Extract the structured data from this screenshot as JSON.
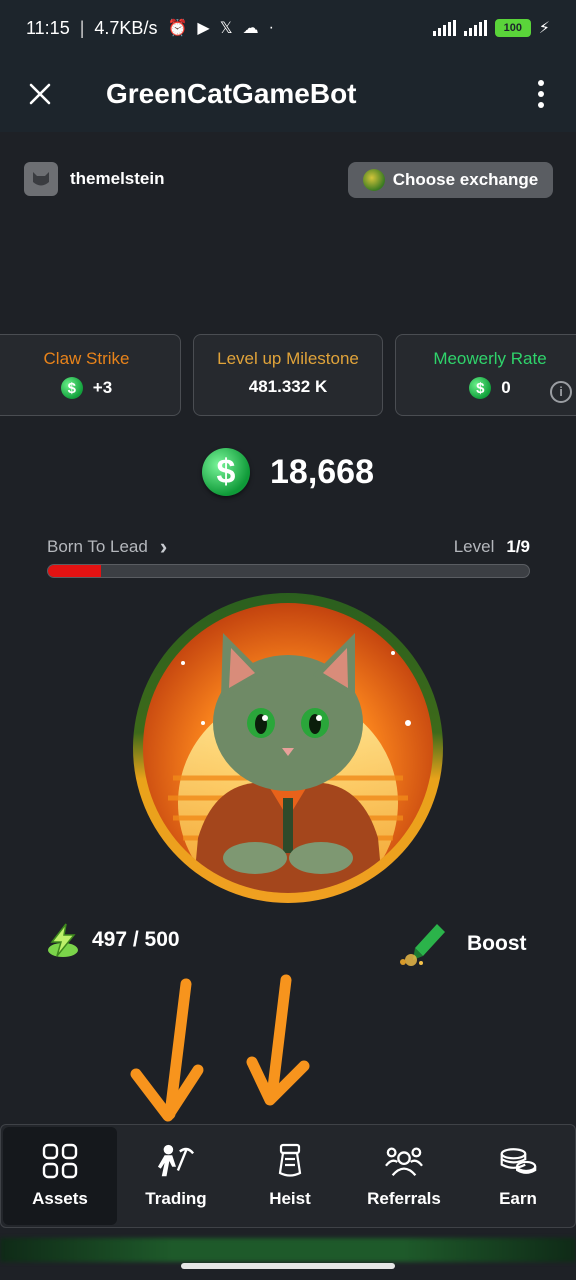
{
  "status_bar": {
    "time": "11:15",
    "speed": "4.7KB/s",
    "battery": "100"
  },
  "app_bar": {
    "title": "GreenCatGameBot"
  },
  "user": {
    "username": "themelstein"
  },
  "exchange_button": {
    "label": "Choose exchange"
  },
  "stats": [
    {
      "label": "Claw Strike",
      "value": "+3",
      "color": "#e8831a"
    },
    {
      "label": "Level up Milestone",
      "value": "481.332 K",
      "color": "#e0a33a"
    },
    {
      "label": "Meowerly Rate",
      "value": "0",
      "color": "#2fd36b"
    }
  ],
  "balance": {
    "amount": "18,668"
  },
  "level": {
    "name": "Born To Lead",
    "label": "Level",
    "value": "1/9",
    "progress": 0.11
  },
  "energy": {
    "value": "497 / 500"
  },
  "boost": {
    "label": "Boost"
  },
  "nav": {
    "items": [
      {
        "label": "Assets",
        "icon": "assets-grid-icon"
      },
      {
        "label": "Trading",
        "icon": "miner-pickaxe-icon"
      },
      {
        "label": "Heist",
        "icon": "money-bag-icon"
      },
      {
        "label": "Referrals",
        "icon": "users-group-icon"
      },
      {
        "label": "Earn",
        "icon": "coins-stack-icon"
      }
    ]
  },
  "colors": {
    "accent_green": "#12a13c",
    "progress_red": "#e31212",
    "arrow_orange": "#f7941d"
  }
}
